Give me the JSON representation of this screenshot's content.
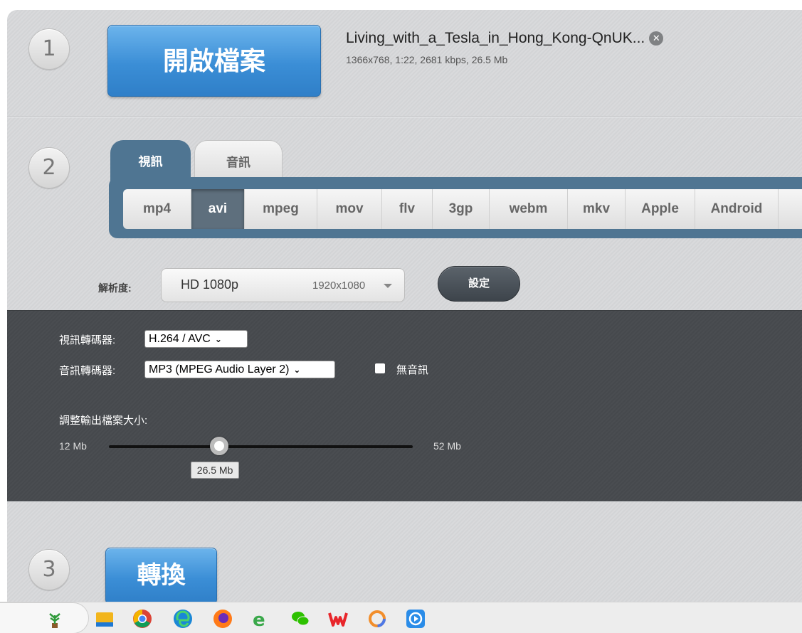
{
  "steps": {
    "one": "1",
    "two": "2",
    "three": "3"
  },
  "open_button": "開啟檔案",
  "file": {
    "name": "Living_with_a_Tesla_in_Hong_Kong-QnUK...",
    "meta": "1366x768, 1:22, 2681 kbps, 26.5 Mb",
    "remove_icon": "close-circle-icon"
  },
  "tabs": [
    {
      "label": "視訊",
      "active": true
    },
    {
      "label": "音訊",
      "active": false
    }
  ],
  "formats": [
    "mp4",
    "avi",
    "mpeg",
    "mov",
    "flv",
    "3gp",
    "webm",
    "mkv",
    "Apple",
    "Android"
  ],
  "active_format": "avi",
  "resolution": {
    "label": "解析度:",
    "name": "HD 1080p",
    "dims": "1920x1080"
  },
  "settings_button": "設定",
  "advanced": {
    "video_codec_label": "視訊轉碼器:",
    "video_codec_value": "H.264 / AVC",
    "audio_codec_label": "音訊轉碼器:",
    "audio_codec_value": "MP3 (MPEG Audio Layer 2)",
    "no_audio_label": "無音訊",
    "no_audio_checked": false,
    "size_label": "調整輸出檔案大小:",
    "size_min": "12 Mb",
    "size_max": "52 Mb",
    "size_value": "26.5 Mb",
    "size_fraction": 0.3625
  },
  "convert_button": "轉換",
  "taskbar": {
    "icons": [
      "plant-app-icon",
      "file-explorer-icon",
      "chrome-icon",
      "edge-icon",
      "firefox-icon",
      "ie-icon",
      "wechat-icon",
      "wps-icon",
      "app-ring-icon",
      "remote-desktop-icon"
    ]
  },
  "colors": {
    "accent_blue": "#3b8ed6",
    "tab_panel": "#4f7592",
    "active_format": "#5e6f7d",
    "dark_panel": "#4a4d51"
  }
}
